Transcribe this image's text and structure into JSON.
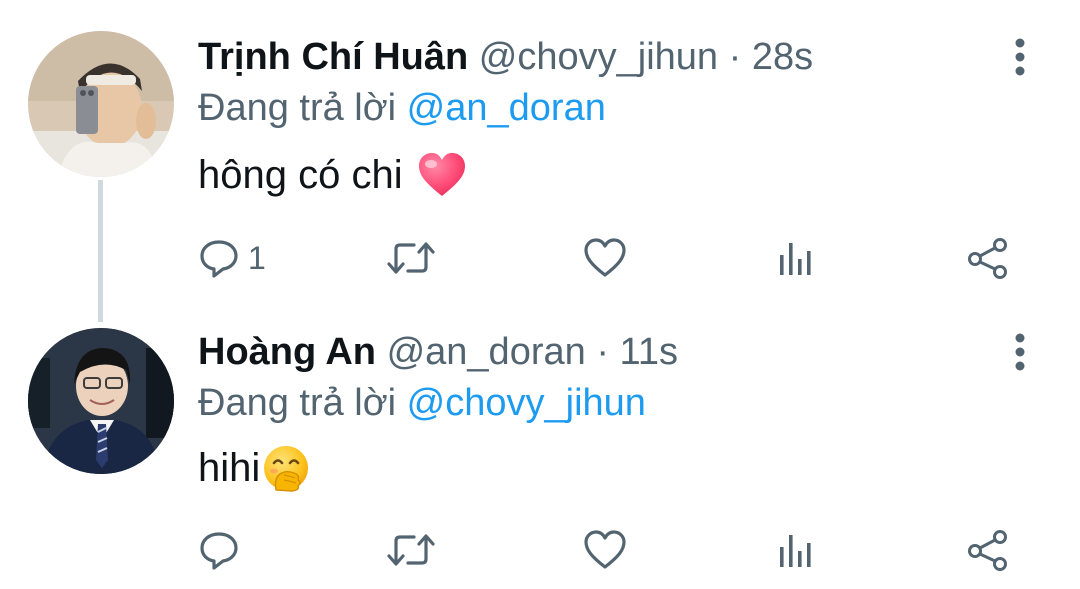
{
  "tweets": [
    {
      "name": "Trịnh Chí Huân",
      "handle": "@chovy_jihun",
      "separator": "·",
      "time": "28s",
      "reply_prefix": "Đang trả lời",
      "reply_to": "@an_doran",
      "text": "hông có chi",
      "emoji": "red-heart",
      "reply_count": "1",
      "actions": [
        "reply-icon",
        "retweet-icon",
        "like-icon",
        "views-icon",
        "share-icon"
      ]
    },
    {
      "name": "Hoàng An",
      "handle": "@an_doran",
      "separator": "·",
      "time": "11s",
      "reply_prefix": "Đang trả lời",
      "reply_to": "@chovy_jihun",
      "text": "hihi",
      "emoji": "face-with-hand-over-mouth",
      "reply_count": "",
      "actions": [
        "reply-icon",
        "retweet-icon",
        "like-icon",
        "views-icon",
        "share-icon"
      ]
    }
  ],
  "colors": {
    "text": "#0f1419",
    "secondary": "#536471",
    "mention": "#1d9bf0",
    "thread_line": "#cfd9de"
  }
}
